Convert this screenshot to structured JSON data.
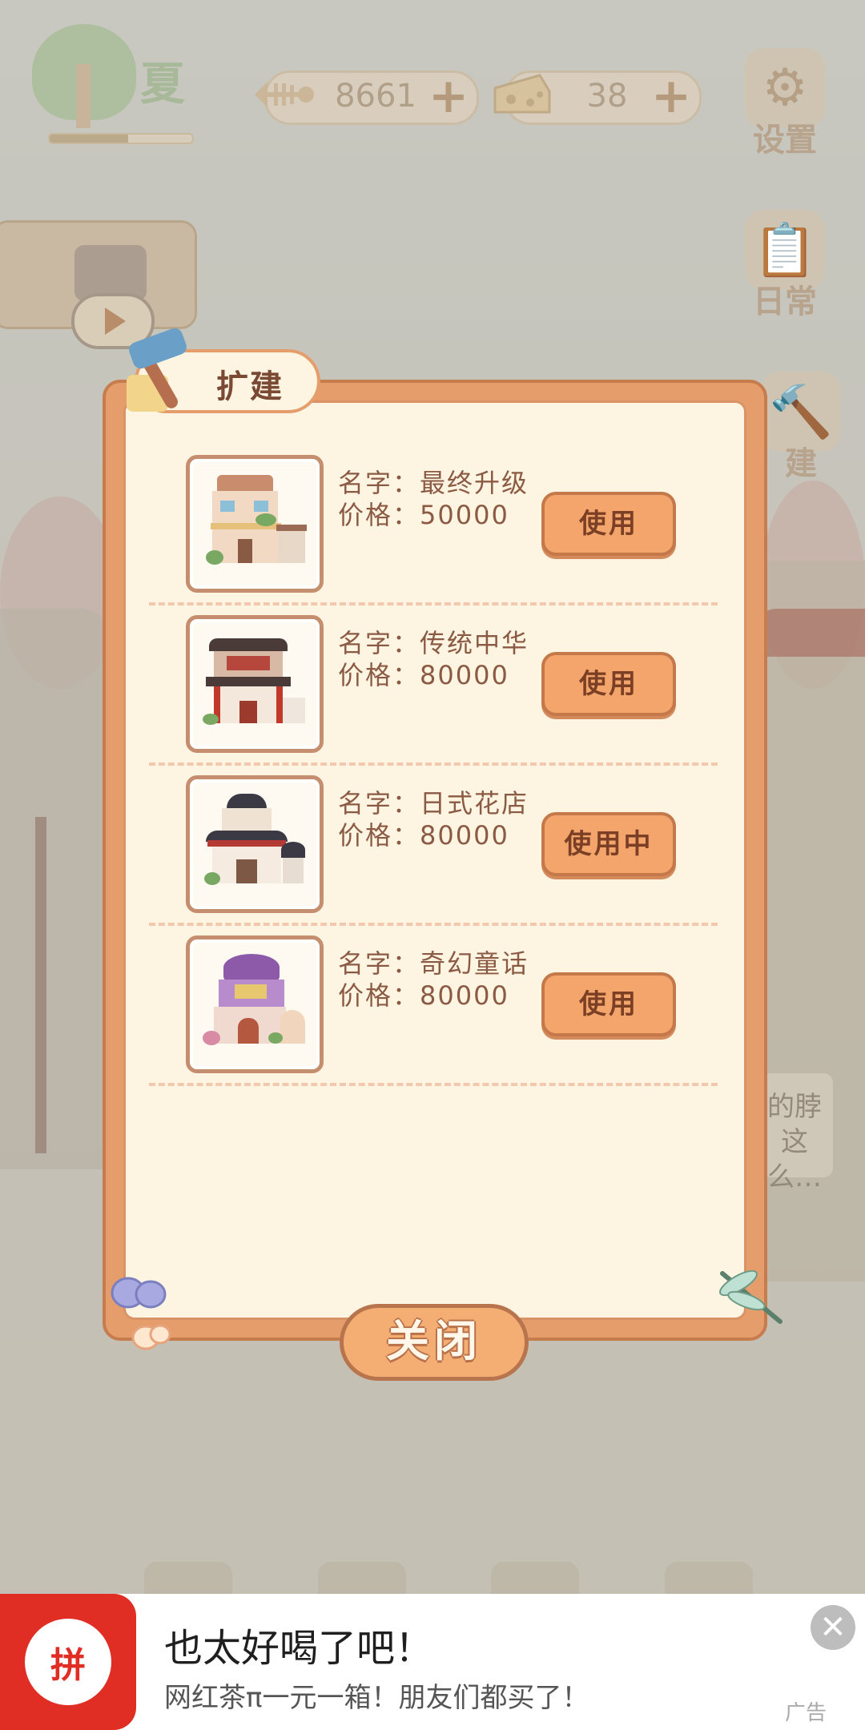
{
  "hud": {
    "season_label": "夏",
    "season_progress": 0.55,
    "fish_bones": "8661",
    "cheese": "38",
    "plus_symbol": "+",
    "settings_label": "设置",
    "daily_label": "日常",
    "expand_label": "建"
  },
  "background": {
    "bubble_text": "的脖这么…"
  },
  "dialog": {
    "title": "扩建",
    "items": [
      {
        "name": "名字：最终升级",
        "price": "价格：50000",
        "button": "使用"
      },
      {
        "name": "名字：传统中华",
        "price": "价格：80000",
        "button": "使用"
      },
      {
        "name": "名字：日式花店",
        "price": "价格：80000",
        "button": "使用中"
      },
      {
        "name": "名字：奇幻童话",
        "price": "价格：80000",
        "button": "使用"
      }
    ],
    "close_label": "关闭"
  },
  "ad": {
    "logo_text": "拼",
    "title": "也太好喝了吧！",
    "description": "网红茶π一元一箱！朋友们都买了！",
    "tag": "广告",
    "close_symbol": "✕"
  },
  "colors": {
    "dialog_border": "#e59d6b",
    "button": "#f3a56c",
    "ad_brand": "#e02e24"
  }
}
